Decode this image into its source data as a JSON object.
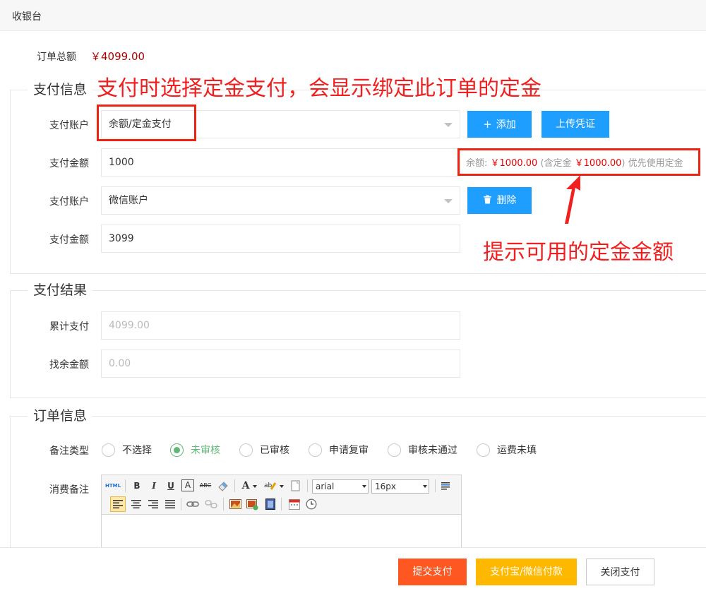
{
  "header": {
    "title": "收银台"
  },
  "order_total": {
    "label": "订单总额",
    "value": "￥4099.00"
  },
  "annotations": {
    "top_text": "支付时选择定金支付，会显示绑定此订单的定金",
    "right_text": "提示可用的定金金额"
  },
  "payment_info": {
    "title": "支付信息",
    "rows": [
      {
        "account_label": "支付账户",
        "account_value": "余额/定金支付",
        "amount_label": "支付金额",
        "amount_value": "1000"
      },
      {
        "account_label": "支付账户",
        "account_value": "微信账户",
        "amount_label": "支付金额",
        "amount_value": "3099"
      }
    ],
    "add_button": "添加",
    "upload_button": "上传凭证",
    "delete_button": "删除",
    "balance_hint": {
      "prefix": "余额:",
      "balance": "￥1000.00",
      "middle": "(含定金",
      "deposit": "￥1000.00",
      "suffix": ") 优先使用定金"
    }
  },
  "payment_result": {
    "title": "支付结果",
    "total_paid_label": "累计支付",
    "total_paid_placeholder": "4099.00",
    "change_label": "找余金额",
    "change_placeholder": "0.00"
  },
  "order_info": {
    "title": "订单信息",
    "remark_type_label": "备注类型",
    "remark_types": [
      "不选择",
      "未审核",
      "已审核",
      "申请复审",
      "审核未通过",
      "运费未填"
    ],
    "selected_remark_type": "未审核",
    "consume_remark_label": "消费备注",
    "editor": {
      "html_btn": "HTML",
      "bold": "B",
      "italic": "I",
      "underline": "U",
      "font_color": "A",
      "strike": "ABC",
      "font_family": "arial",
      "font_size": "16px"
    }
  },
  "footer": {
    "submit": "提交支付",
    "alipay_wechat": "支付宝/微信付款",
    "close": "关闭支付"
  },
  "colors": {
    "primary_blue": "#1e9fff",
    "submit_orange": "#ff5722",
    "alipay_yellow": "#ffb800",
    "checked_green": "#5fb878",
    "annotation_red": "#f02020"
  }
}
